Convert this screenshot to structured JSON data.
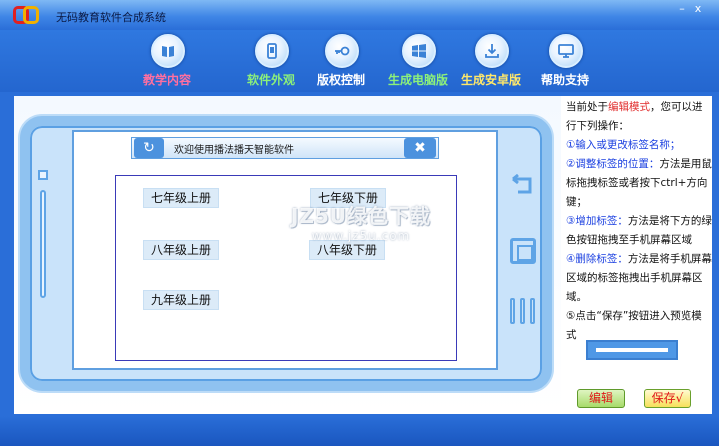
{
  "window": {
    "title": "无码教育软件合成系统",
    "minimize_glyph": "–",
    "close_glyph": "x"
  },
  "toolbar": {
    "items": [
      {
        "label": "教学内容",
        "icon": "book-icon",
        "color": "#ff6fa0"
      },
      {
        "label": "软件外观",
        "icon": "phone-icon",
        "color": "#8cf07a"
      },
      {
        "label": "版权控制",
        "icon": "key-icon",
        "color": "#ffffff"
      },
      {
        "label": "生成电脑版",
        "icon": "windows-icon",
        "color": "#8cf07a"
      },
      {
        "label": "生成安卓版",
        "icon": "download-icon",
        "color": "#ffe86a"
      },
      {
        "label": "帮助支持",
        "icon": "monitor-icon",
        "color": "#ffffff"
      }
    ]
  },
  "screen": {
    "title": "欢迎使用播法播天智能软件",
    "refresh_glyph": "↻",
    "close_glyph": "✖",
    "labels": [
      "七年级上册",
      "七年级下册",
      "八年级上册",
      "八年级下册",
      "九年级上册"
    ]
  },
  "watermark": {
    "main": "JZ5U绿色下载",
    "sub": "www.jz5u.com"
  },
  "side": {
    "intro_prefix": "当前处于",
    "intro_mode": "编辑模式",
    "intro_suffix": "，您可以进行下列操作：",
    "step1": "①输入或更改标签名称；",
    "step2_title": "②调整标签的位置：",
    "step2_body": "方法是用鼠标拖拽标签或者按下ctrl+方向键；",
    "step3_title": "③增加标签：",
    "step3_body": "方法是将下方的绿色按钮拖拽至手机屏幕区域",
    "step4_title": "④删除标签：",
    "step4_body": "方法是将手机屏幕区域的标签拖拽出手机屏幕区域。",
    "step5": "⑤点击“保存”按钮进入预览模式",
    "edit_label": "编辑",
    "save_label": "保存√"
  }
}
